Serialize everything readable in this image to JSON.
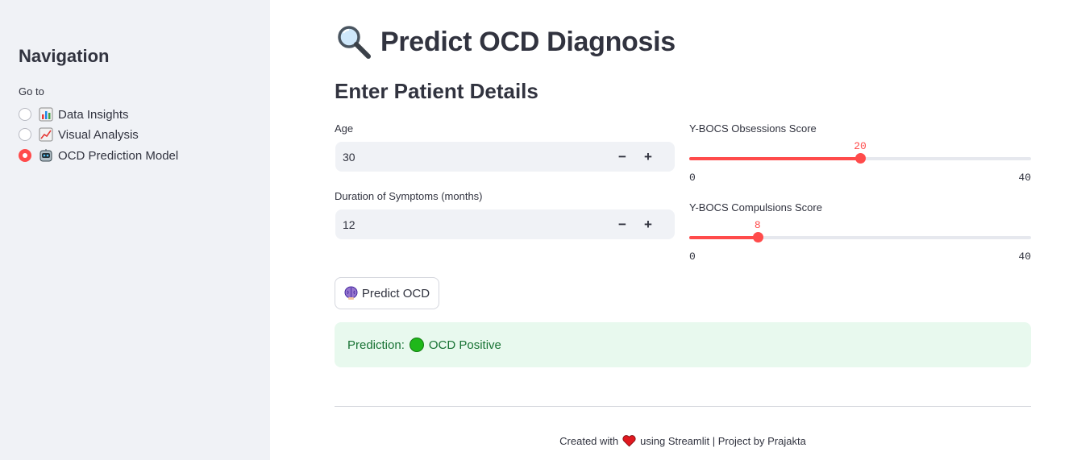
{
  "sidebar": {
    "title": "Navigation",
    "goto_label": "Go to",
    "options": [
      {
        "label": "Data Insights",
        "icon": "bar-chart-icon",
        "selected": false
      },
      {
        "label": "Visual Analysis",
        "icon": "line-chart-icon",
        "selected": false
      },
      {
        "label": "OCD Prediction Model",
        "icon": "robot-icon",
        "selected": true
      }
    ]
  },
  "main": {
    "title": "Predict OCD Diagnosis",
    "title_icon": "magnifier-icon",
    "section_title": "Enter Patient Details",
    "age": {
      "label": "Age",
      "value": "30"
    },
    "duration": {
      "label": "Duration of Symptoms (months)",
      "value": "12"
    },
    "obsessions": {
      "label": "Y-BOCS Obsessions Score",
      "value": "20",
      "min": "0",
      "max": "40"
    },
    "compulsions": {
      "label": "Y-BOCS Compulsions Score",
      "value": "8",
      "min": "0",
      "max": "40"
    },
    "predict_button": "Predict OCD",
    "prediction_label": "Prediction:",
    "prediction_value": "OCD Positive"
  },
  "footer": {
    "left": "Created with",
    "right": "using Streamlit | Project by Prajakta"
  },
  "colors": {
    "accent": "#ff4b4b",
    "sidebar_bg": "#f0f2f6",
    "success_bg": "#e8f9ee",
    "success_text": "#177233"
  }
}
